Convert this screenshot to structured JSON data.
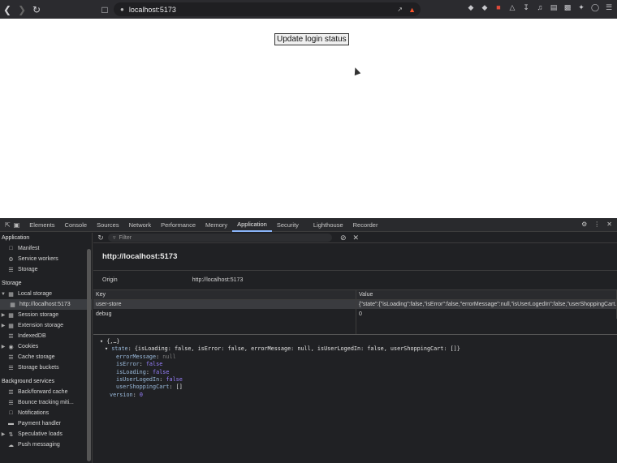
{
  "browser": {
    "url": "localhost:5173"
  },
  "page": {
    "button_label": "Update login status"
  },
  "devtools": {
    "tabs": [
      "Elements",
      "Console",
      "Sources",
      "Network",
      "Performance",
      "Memory",
      "Application",
      "Security",
      "Lighthouse",
      "Recorder"
    ],
    "active_tab": "Application",
    "sidebar": {
      "application_header": "Application",
      "application_items": [
        "Manifest",
        "Service workers",
        "Storage"
      ],
      "storage_header": "Storage",
      "local_storage": "Local storage",
      "local_storage_child": "http://localhost:5173",
      "storage_items": [
        "Session storage",
        "Extension storage",
        "IndexedDB",
        "Cookies",
        "Cache storage",
        "Storage buckets"
      ],
      "bg_header": "Background services",
      "bg_items": [
        "Back/forward cache",
        "Bounce tracking miti...",
        "Notifications",
        "Payment handler",
        "Speculative loads",
        "Push messaging"
      ]
    },
    "filter_placeholder": "Filter",
    "origin_title": "http://localhost:5173",
    "origin_label": "Origin",
    "origin_value": "http://localhost:5173",
    "table": {
      "headers": [
        "Key",
        "Value"
      ],
      "rows": [
        {
          "key": "user-store",
          "value": "{\"state\":{\"isLoading\":false,\"isError\":false,\"errorMessage\":null,\"isUserLogedIn\":false,\"userShoppingCart..."
        },
        {
          "key": "debug",
          "value": "0"
        }
      ]
    },
    "preview": {
      "root": "{,…}",
      "state_label": "state",
      "state_summary": "{isLoading: false, isError: false, errorMessage: null, isUserLogedIn: false, userShoppingCart: []}",
      "fields": [
        {
          "k": "errorMessage",
          "v": "null",
          "kind": "n"
        },
        {
          "k": "isError",
          "v": "false",
          "kind": "b"
        },
        {
          "k": "isLoading",
          "v": "false",
          "kind": "b"
        },
        {
          "k": "isUserLogedIn",
          "v": "false",
          "kind": "b"
        },
        {
          "k": "userShoppingCart",
          "v": "[]",
          "kind": "p"
        }
      ],
      "version_label": "version",
      "version_value": "0"
    }
  }
}
